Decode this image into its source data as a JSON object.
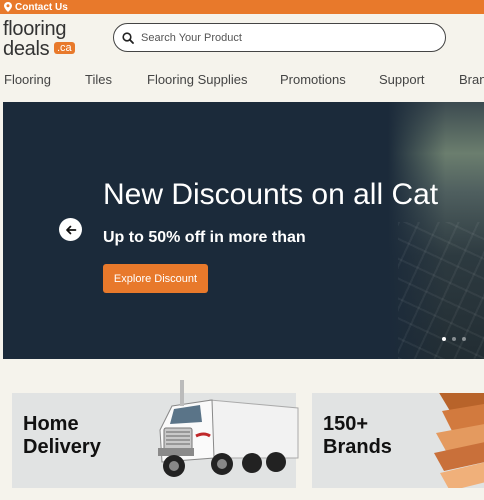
{
  "topbar": {
    "contact_label": "Contact Us"
  },
  "logo": {
    "line1": "flooring",
    "line2": "deals",
    "badge": ".ca"
  },
  "search": {
    "placeholder": "Search Your Product"
  },
  "nav": {
    "items": [
      "Flooring",
      "Tiles",
      "Flooring Supplies",
      "Promotions",
      "Support",
      "Bran"
    ]
  },
  "hero": {
    "title": "New Discounts on all Cat",
    "subtitle": "Up to 50% off in more than",
    "button_label": "Explore Discount",
    "slide_count": 3,
    "active_slide": 1
  },
  "cards": [
    {
      "title_line1": "Home",
      "title_line2": "Delivery"
    },
    {
      "title_line1": "150+",
      "title_line2": "Brands"
    }
  ],
  "colors": {
    "accent": "#e8792b",
    "hero_bg": "#1b2a3a",
    "page_bg": "#f5f3ec",
    "card_bg": "#e1e3e3"
  }
}
